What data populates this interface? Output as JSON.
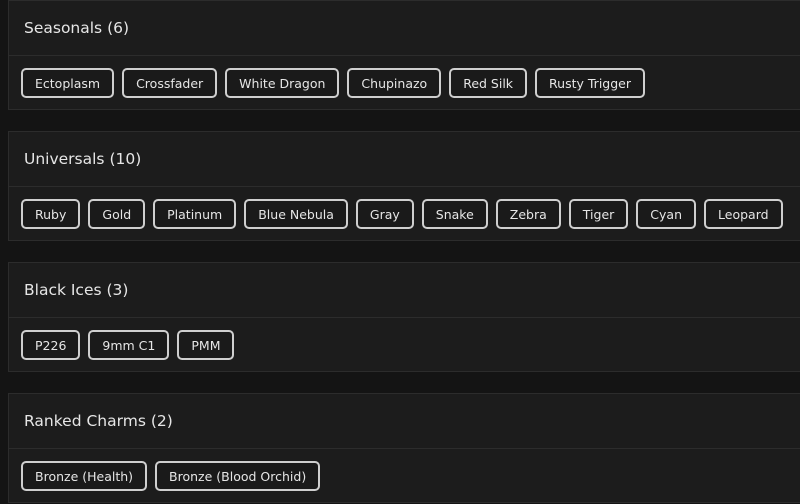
{
  "sections": [
    {
      "title": "Seasonals (6)",
      "items": [
        "Ectoplasm",
        "Crossfader",
        "White Dragon",
        "Chupinazo",
        "Red Silk",
        "Rusty Trigger"
      ]
    },
    {
      "title": "Universals (10)",
      "items": [
        "Ruby",
        "Gold",
        "Platinum",
        "Blue Nebula",
        "Gray",
        "Snake",
        "Zebra",
        "Tiger",
        "Cyan",
        "Leopard"
      ]
    },
    {
      "title": "Black Ices (3)",
      "items": [
        "P226",
        "9mm C1",
        "PMM"
      ]
    },
    {
      "title": "Ranked Charms (2)",
      "items": [
        "Bronze (Health)",
        "Bronze (Blood Orchid)"
      ]
    }
  ]
}
